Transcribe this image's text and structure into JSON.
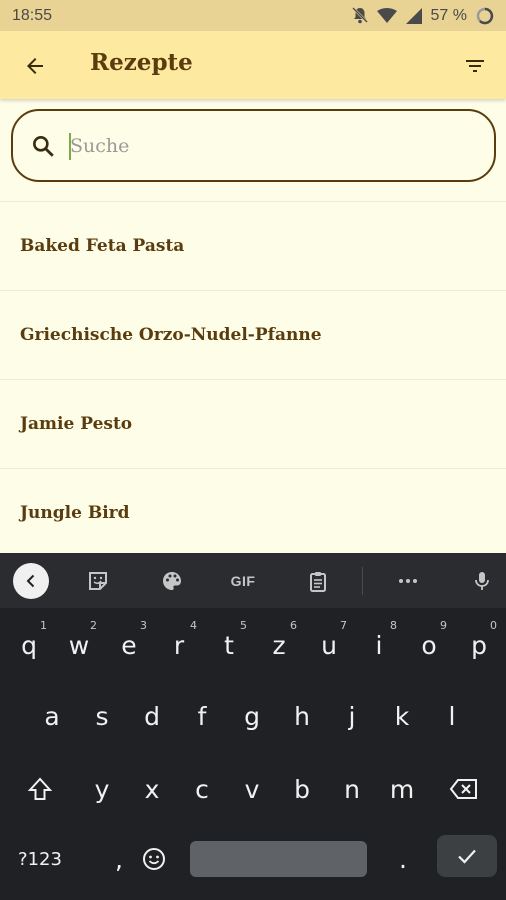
{
  "status_bar": {
    "time": "18:55",
    "battery": "57 %"
  },
  "app_bar": {
    "title": "Rezepte"
  },
  "search": {
    "placeholder": "Suche",
    "value": ""
  },
  "recipes": [
    "Baked Feta Pasta",
    "Griechische Orzo-Nudel-Pfanne",
    "Jamie Pesto",
    "Jungle Bird"
  ],
  "keyboard": {
    "toolbar": {
      "gif_label": "GIF"
    },
    "row1": [
      {
        "key": "q",
        "hint": "1"
      },
      {
        "key": "w",
        "hint": "2"
      },
      {
        "key": "e",
        "hint": "3"
      },
      {
        "key": "r",
        "hint": "4"
      },
      {
        "key": "t",
        "hint": "5"
      },
      {
        "key": "z",
        "hint": "6"
      },
      {
        "key": "u",
        "hint": "7"
      },
      {
        "key": "i",
        "hint": "8"
      },
      {
        "key": "o",
        "hint": "9"
      },
      {
        "key": "p",
        "hint": "0"
      }
    ],
    "row2": [
      "a",
      "s",
      "d",
      "f",
      "g",
      "h",
      "j",
      "k",
      "l"
    ],
    "row3": [
      "y",
      "x",
      "c",
      "v",
      "b",
      "n",
      "m"
    ],
    "row4": {
      "symbols": "?123",
      "comma": ",",
      "period": "."
    }
  },
  "colors": {
    "status_bar": "#e8d394",
    "app_bar": "#fde9a0",
    "background": "#fefde8",
    "text_brown": "#5a3c0e",
    "keyboard": "#202124"
  }
}
